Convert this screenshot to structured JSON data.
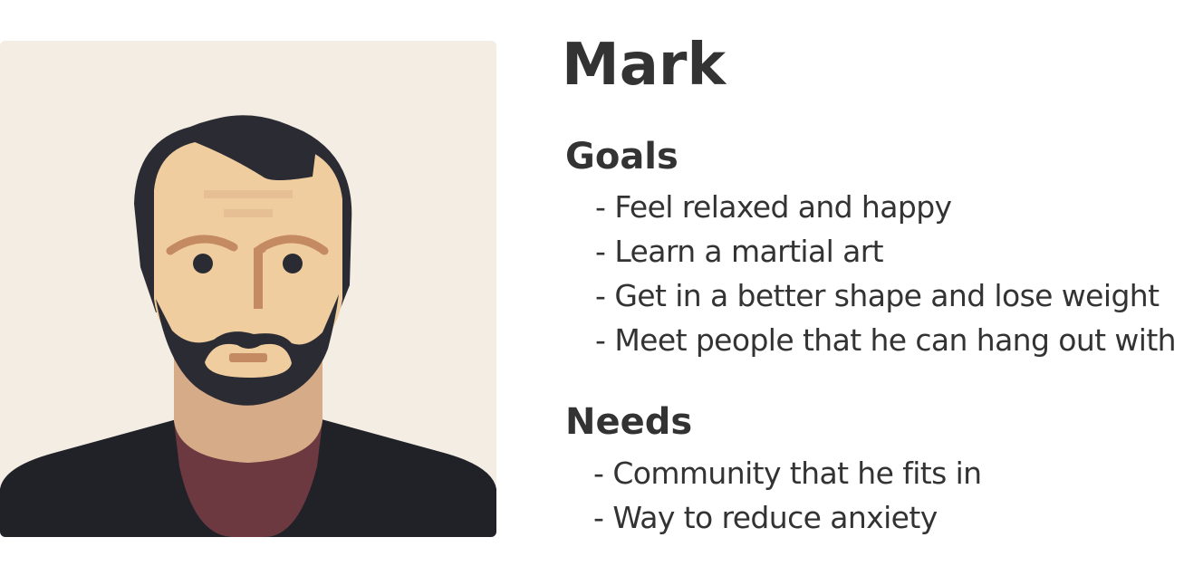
{
  "persona": {
    "name": "Mark",
    "avatar_icon": "man-with-beard-avatar-icon"
  },
  "goals": {
    "heading": "Goals",
    "items": [
      "Feel relaxed and happy",
      "Learn a martial art",
      "Get in a better shape and lose weight",
      "Meet people that he can hang out with"
    ]
  },
  "needs": {
    "heading": "Needs",
    "items": [
      "Community that he fits in",
      "Way to reduce anxiety"
    ]
  },
  "bullet": "-",
  "colors": {
    "text": "#333333",
    "avatar_background": "#f4ede4",
    "hair_and_beard": "#2b2c33",
    "skin": "#f0cd9e",
    "neck": "#d6ac88",
    "shirt": "#6d3940",
    "jacket": "#202228"
  }
}
